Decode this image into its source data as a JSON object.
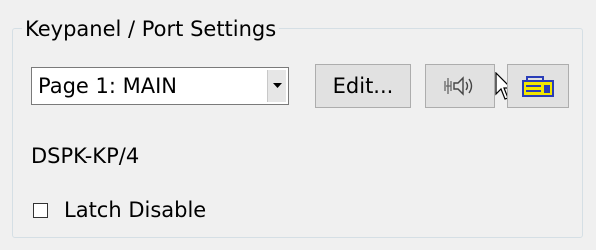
{
  "group": {
    "title": "Keypanel / Port Settings"
  },
  "page_select": {
    "selected": "Page 1: MAIN"
  },
  "buttons": {
    "edit_label": "Edit..."
  },
  "icons": {
    "dropdown_arrow": "chevron-down-icon",
    "speaker": "speaker-icon",
    "port": "port-device-icon",
    "cursor": "mouse-pointer-icon"
  },
  "device": {
    "label": "DSPK-KP/4"
  },
  "latch_disable": {
    "label": "Latch Disable",
    "checked": false
  },
  "colors": {
    "background": "#f0f0f0",
    "groupbox_border": "#d5dfe5",
    "button_face": "#e1e1e1",
    "port_icon_yellow": "#f2e600",
    "port_icon_blue": "#2a3db8"
  }
}
